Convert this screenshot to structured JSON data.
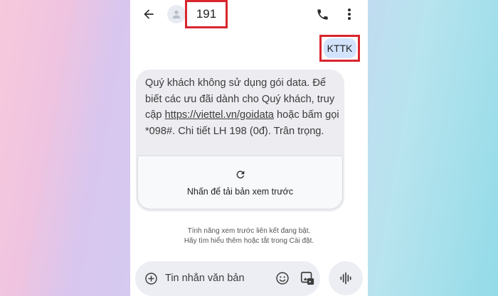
{
  "header": {
    "contact_name": "191"
  },
  "icons": {
    "back": "back-arrow-icon",
    "avatar": "person-icon",
    "call": "phone-icon",
    "more": "more-vertical-icon",
    "refresh": "refresh-icon",
    "add": "add-circle-icon",
    "emoji": "emoji-icon",
    "gallery": "gallery-icon",
    "voice": "voice-wave-icon"
  },
  "messages": {
    "sent": {
      "text": "KTTK"
    },
    "received": {
      "text_part1": "Quý khách không sử dụng gói data. Để biết các ưu đãi dành cho Quý khách, truy cập ",
      "link": "https://viettel.vn/goidata",
      "text_part2": " hoặc bấm gọi *098#. Chi tiết LH 198 (0đ). Trân trọng.",
      "preview_label": "Nhấn để tải bản xem trước"
    }
  },
  "notice": {
    "line1": "Tính năng xem trước liên kết đang bật.",
    "line2": "Hãy tìm hiểu thêm hoặc tắt trong Cài đặt."
  },
  "composer": {
    "placeholder": "Tin nhắn văn bản"
  },
  "colors": {
    "highlight_border": "#d9252d",
    "sent_bubble": "#d3e3fd",
    "received_bubble": "#ececf1"
  }
}
